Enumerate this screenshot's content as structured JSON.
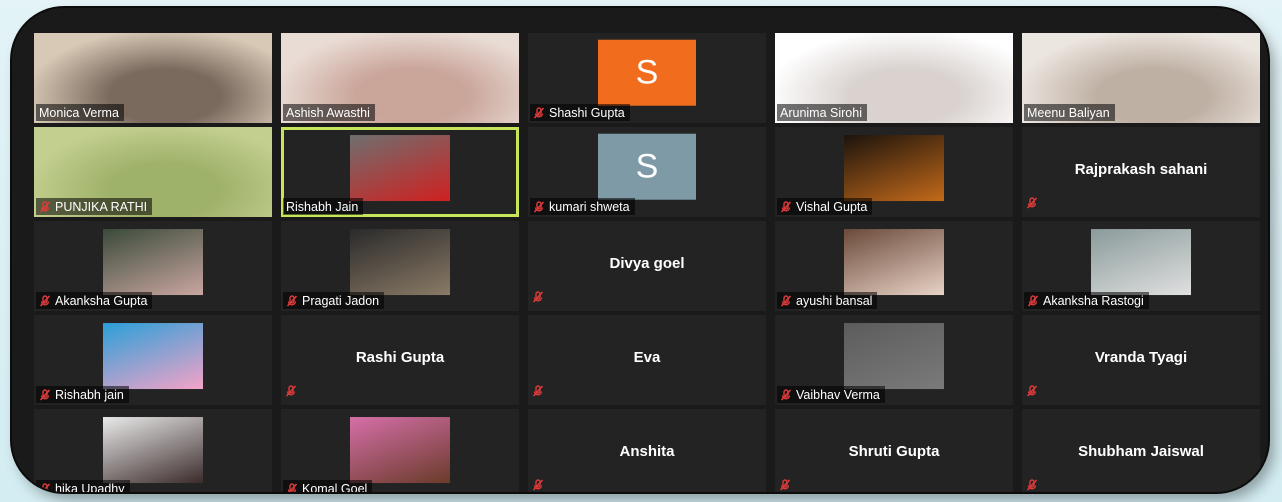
{
  "participants": [
    {
      "name": "Monica Verma",
      "muted": false,
      "kind": "video",
      "bg": [
        "#7a6a5e",
        "#d8c9b6"
      ]
    },
    {
      "name": "Ashish Awasthi",
      "muted": false,
      "kind": "video",
      "bg": [
        "#caa59a",
        "#e9dcd5"
      ]
    },
    {
      "name": "Shashi Gupta",
      "muted": true,
      "kind": "letter",
      "letter": "S",
      "avatar_color": "#f26c1e"
    },
    {
      "name": "Arunima Sirohi",
      "muted": false,
      "kind": "video",
      "bg": [
        "#d9d2cf",
        "#ffffff"
      ]
    },
    {
      "name": "Meenu Baliyan",
      "muted": false,
      "kind": "video",
      "bg": [
        "#bfb0a4",
        "#ece6e0"
      ]
    },
    {
      "name": "PUNJIKA RATHI",
      "muted": true,
      "kind": "video",
      "bg": [
        "#9fb26a",
        "#c3cf8f"
      ]
    },
    {
      "name": "Rishabh Jain",
      "muted": false,
      "kind": "thumb",
      "active": true,
      "thumb": [
        "#6f6f6f",
        "#d02020"
      ]
    },
    {
      "name": "kumari shweta",
      "muted": true,
      "kind": "letter",
      "letter": "S",
      "avatar_color": "#7e9aa6"
    },
    {
      "name": "Vishal Gupta",
      "muted": true,
      "kind": "thumb",
      "thumb": [
        "#1b130c",
        "#c46a1a"
      ]
    },
    {
      "name": "Rajprakash sahani",
      "muted": true,
      "kind": "text"
    },
    {
      "name": "Akanksha Gupta",
      "muted": true,
      "kind": "thumb",
      "thumb": [
        "#3a4a3a",
        "#c9a6a0"
      ]
    },
    {
      "name": "Pragati Jadon",
      "muted": true,
      "kind": "thumb",
      "thumb": [
        "#2a2a2a",
        "#8a7a66"
      ]
    },
    {
      "name": "Divya goel",
      "muted": true,
      "kind": "text"
    },
    {
      "name": "ayushi bansal",
      "muted": true,
      "kind": "thumb",
      "thumb": [
        "#6a4a3a",
        "#e8d2c6"
      ]
    },
    {
      "name": "Akanksha Rastogi",
      "muted": true,
      "kind": "thumb",
      "thumb": [
        "#8a9a9a",
        "#e0e0e0"
      ]
    },
    {
      "name": "Rishabh jain",
      "muted": true,
      "kind": "thumb",
      "thumb": [
        "#2b9fd8",
        "#f4a3c8"
      ]
    },
    {
      "name": "Rashi Gupta",
      "muted": true,
      "kind": "text"
    },
    {
      "name": "Eva",
      "muted": true,
      "kind": "text"
    },
    {
      "name": "Vaibhav Verma",
      "muted": true,
      "kind": "thumb",
      "thumb": [
        "#5c5c5c",
        "#7a7a7a"
      ]
    },
    {
      "name": "Vranda Tyagi",
      "muted": true,
      "kind": "text"
    },
    {
      "name": "hika Upadhy",
      "muted": true,
      "kind": "thumb",
      "thumb": [
        "#eaeaea",
        "#3b2b2b"
      ]
    },
    {
      "name": "Komal Goel",
      "muted": true,
      "kind": "thumb",
      "thumb": [
        "#d56fa8",
        "#6a3b2a"
      ]
    },
    {
      "name": "Anshita",
      "muted": true,
      "kind": "text"
    },
    {
      "name": "Shruti Gupta",
      "muted": true,
      "kind": "text"
    },
    {
      "name": "Shubham Jaiswal",
      "muted": true,
      "kind": "text"
    }
  ],
  "colors": {
    "mute_icon": "#e03a3a",
    "active_border": "#c6e55b"
  }
}
